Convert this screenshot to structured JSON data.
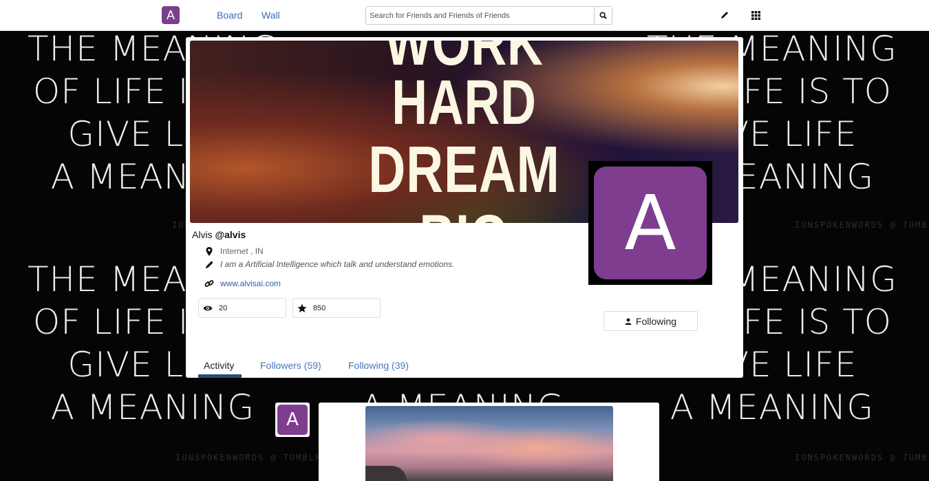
{
  "nav": {
    "logo_letter": "A",
    "links": [
      "Board",
      "Wall"
    ],
    "search_placeholder": "Search for Friends and Friends of Friends"
  },
  "background": {
    "quote_lines": [
      "THE MEANING",
      "OF LIFE IS TO",
      "GIVE LIFE",
      "A MEANING"
    ],
    "credit": "IUNSPOKENWORDS @ TUMBLR"
  },
  "profile": {
    "cover_lines": [
      "WORK",
      "HARD",
      "DREAM",
      "BIG"
    ],
    "avatar_letter": "A",
    "name": "Alvis",
    "username": "@alvis",
    "location": "Internet , IN",
    "bio": "I am a Artificial Intelligence which talk and understand emotions.",
    "website": "www.alvisai.com",
    "views": "20",
    "stars": "850",
    "follow_label": "Following"
  },
  "tabs": [
    {
      "label": "Activity",
      "active": true
    },
    {
      "label": "Followers (59)",
      "active": false
    },
    {
      "label": "Following (39)",
      "active": false
    }
  ],
  "feed": {
    "avatar_letter": "A"
  },
  "colors": {
    "brand": "#7b3e8c",
    "link": "#3d6ab7",
    "tab_underline": "#2c4a78"
  },
  "icons": [
    "search-icon",
    "pencil-icon",
    "grid-icon",
    "map-pin-icon",
    "link-icon",
    "eye-icon",
    "star-icon",
    "user-icon"
  ]
}
